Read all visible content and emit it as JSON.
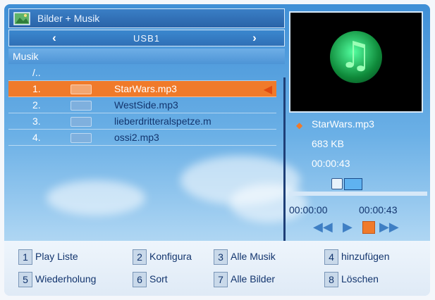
{
  "window": {
    "title": "Bilder + Musik"
  },
  "source": {
    "label": "USB1",
    "prev_icon": "chevron-left-icon",
    "next_icon": "chevron-right-icon"
  },
  "folder": {
    "label": "Musik",
    "up_entry": "/.."
  },
  "files": [
    {
      "num": "1.",
      "name": "StarWars.mp3",
      "selected": true
    },
    {
      "num": "2.",
      "name": "WestSide.mp3",
      "selected": false
    },
    {
      "num": "3.",
      "name": "lieberdritteralspetze.m",
      "selected": false
    },
    {
      "num": "4.",
      "name": "ossi2.mp3",
      "selected": false
    }
  ],
  "info": {
    "name": "StarWars.mp3",
    "size": "683 KB",
    "duration": "00:00:43"
  },
  "player": {
    "elapsed": "00:00:00",
    "total": "00:00:43",
    "progress": 0.0
  },
  "footer": [
    {
      "key": "1",
      "label": "Play Liste"
    },
    {
      "key": "2",
      "label": "Konfigura"
    },
    {
      "key": "3",
      "label": "Alle Musik"
    },
    {
      "key": "4",
      "label": "hinzufügen"
    },
    {
      "key": "5",
      "label": "Wiederholung"
    },
    {
      "key": "6",
      "label": "Sort"
    },
    {
      "key": "7",
      "label": "Alle Bilder"
    },
    {
      "key": "8",
      "label": "Löschen"
    }
  ],
  "colors": {
    "accent": "#f07a2a",
    "panel": "#2f6fb6",
    "text_dark": "#13356e"
  }
}
